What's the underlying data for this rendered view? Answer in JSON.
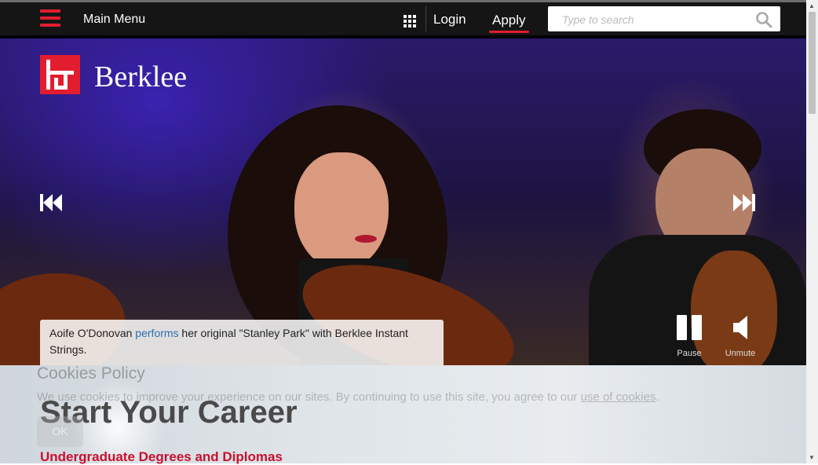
{
  "nav": {
    "menu_label": "Main Menu",
    "login": "Login",
    "apply": "Apply",
    "search_placeholder": "Type to search",
    "accent": "#e21d2f"
  },
  "hero": {
    "logo_text": "Berklee",
    "caption_before": "Aoife O'Donovan ",
    "caption_link": "performs",
    "caption_after": " her original \"Stanley Park\" with Berklee Instant Strings.",
    "pause_label": "Pause",
    "unmute_label": "Unmute",
    "icons": [
      "menu-icon",
      "apps-grid-icon",
      "search-icon",
      "previous-icon",
      "next-icon",
      "pause-icon",
      "speaker-icon"
    ]
  },
  "cookies": {
    "title": "Cookies Policy",
    "text": "We use cookies to improve your experience on our sites. By continuing to use this site, you agree to our ",
    "link": "use of cookies",
    "text_end": ".",
    "ok": "OK"
  },
  "main": {
    "heading": "Start Your Career",
    "subheading": "Undergraduate Degrees and Diplomas"
  }
}
